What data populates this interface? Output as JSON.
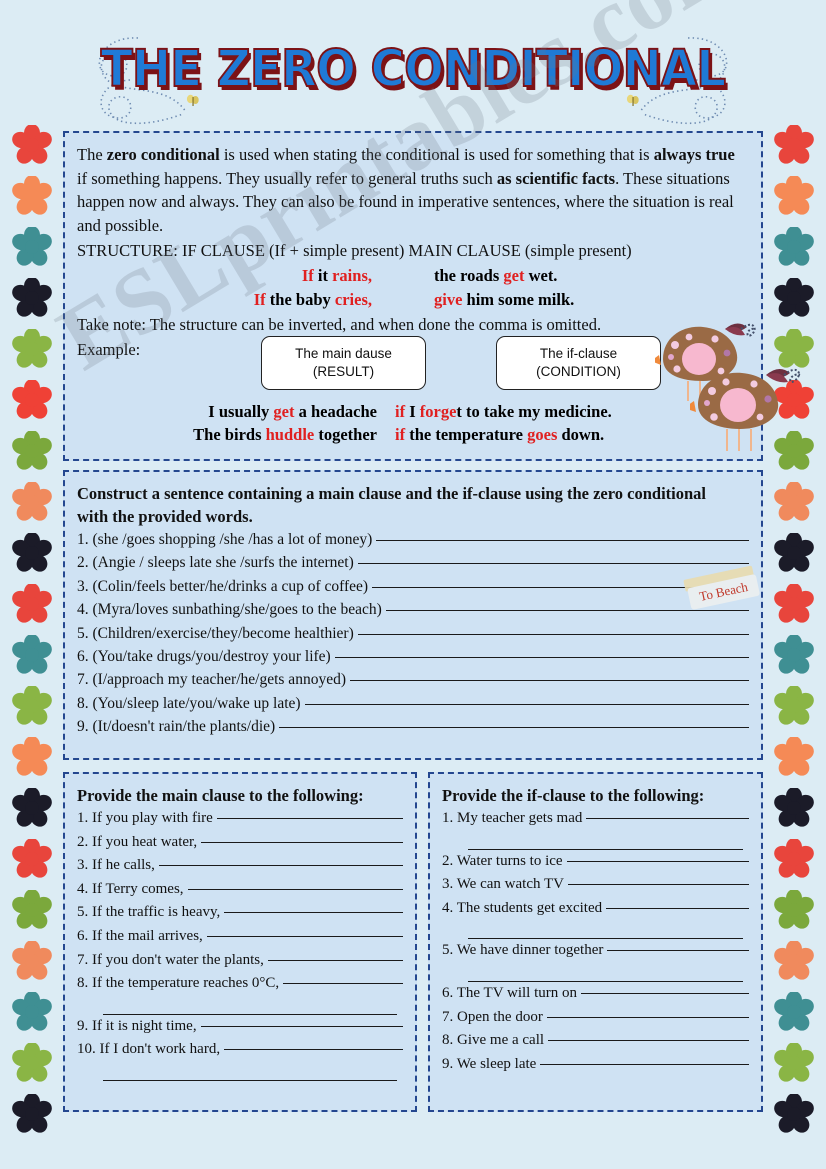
{
  "title": "THE ZERO CONDITIONAL",
  "watermark": "ESLprintables.com",
  "colors": {
    "page_background": "#dcecf4",
    "panel_background": "#cfe2f3",
    "panel_border": "#24478f",
    "title_fill": "#1f7ad6",
    "title_shadow": "#7c1216",
    "highlight_red": "#e02020"
  },
  "explanation": {
    "paragraph_parts": [
      {
        "text": "The ",
        "bold": false
      },
      {
        "text": "zero conditional",
        "bold": true
      },
      {
        "text": " is used when stating the conditional is used for something that is ",
        "bold": false
      },
      {
        "text": "always true",
        "bold": true
      },
      {
        "text": " if something happens. They usually refer to general truths such ",
        "bold": false
      },
      {
        "text": "as scientific facts",
        "bold": true
      },
      {
        "text": ". These situations happen now and always. They can also be found in imperative sentences, where the situation is real and possible.",
        "bold": false
      }
    ],
    "paragraph_plain": "The zero conditional is used when stating the conditional is used for something that is always true if something happens. They usually refer to general truths such as scientific facts. These situations happen now and always. They can also be found in imperative sentences, where the situation is real and possible.",
    "structure_line": "STRUCTURE: IF CLAUSE (If + simple present)   MAIN CLAUSE (simple present)",
    "examples": [
      {
        "if_pre": "If",
        "if_highlight": " it rains,",
        "if_plain_1": " it ",
        "if_word": "rains,",
        "main_pre": "the roads ",
        "main_word": "get",
        "main_post": " wet."
      },
      {
        "if_pre": "If",
        "if_plain_1": " the baby ",
        "if_word": "cries,",
        "main_pre": "",
        "main_word": "give",
        "main_post": " him some milk."
      }
    ],
    "example_1_if_lead": "If",
    "example_1_if_mid": " it ",
    "example_1_if_red": "rains,",
    "example_1_main_lead": "the roads ",
    "example_1_main_red": "get",
    "example_1_main_tail": " wet.",
    "example_2_if_lead": "If",
    "example_2_if_mid": " the baby ",
    "example_2_if_red": "cries,",
    "example_2_main_red": "give",
    "example_2_main_tail": " him some milk.",
    "take_note": "Take note: The structure can be inverted, and when done the comma is omitted.",
    "example_label": "Example:",
    "box_main": {
      "line1": "The main dause",
      "line2": "(RESULT)"
    },
    "box_if": {
      "line1": "The if-clause",
      "line2": "(CONDITION)"
    },
    "inverted_examples": [
      {
        "left_pre": "I usually ",
        "left_red": "get",
        "left_post": " a headache",
        "right_red1": "if",
        "right_mid": " I ",
        "right_red2": "forge",
        "right_post": "t to take my medicine."
      },
      {
        "left_pre": "The birds ",
        "left_red": "huddle",
        "left_post": " together",
        "right_red1": "if",
        "right_mid": " the temperature ",
        "right_red2": "goes",
        "right_post": " down."
      }
    ]
  },
  "construct": {
    "instruction_line1": "Construct a sentence containing a main clause and the if-clause using the zero conditional",
    "instruction_line2": "with the provided words.",
    "items": [
      "1. (she /goes shopping /she /has a lot of money)",
      "2. (Angie / sleeps late  she /surfs the internet)",
      "3. (Colin/feels better/he/drinks a cup of coffee)",
      "4. (Myra/loves sunbathing/she/goes to the beach)",
      "5. (Children/exercise/they/become healthier)",
      "6. (You/take drugs/you/destroy your life)",
      "7. (I/approach my teacher/he/gets annoyed)",
      "8. (You/sleep late/you/wake up late)",
      "9. (It/doesn't rain/the plants/die)"
    ]
  },
  "main_clause_section": {
    "heading": "Provide the main clause to the following:",
    "items": [
      {
        "text": "1. If you play with fire",
        "continuation": false
      },
      {
        "text": "2. If you heat water,",
        "continuation": false
      },
      {
        "text": "3. If he calls,",
        "continuation": false
      },
      {
        "text": "4. If Terry comes,",
        "continuation": false
      },
      {
        "text": "5. If the traffic is heavy,",
        "continuation": false
      },
      {
        "text": "6. If  the mail arrives,",
        "continuation": false
      },
      {
        "text": "7. If you don't water the plants,",
        "continuation": false
      },
      {
        "text": "8. If  the temperature reaches 0°C,",
        "continuation": true
      },
      {
        "text": "9. If it is night time,",
        "continuation": false
      },
      {
        "text": "10. If I don't work hard,",
        "continuation": true
      }
    ]
  },
  "if_clause_section": {
    "heading": "Provide the if-clause to the following:",
    "items": [
      {
        "text": "1. My teacher gets mad",
        "continuation": true
      },
      {
        "text": "2. Water turns to ice",
        "continuation": false
      },
      {
        "text": "3. We can watch TV",
        "continuation": false
      },
      {
        "text": "4. The students get excited",
        "continuation": true
      },
      {
        "text": "5. We have dinner together",
        "continuation": true
      },
      {
        "text": "6. The TV will turn on",
        "continuation": false
      },
      {
        "text": "7. Open the door",
        "continuation": false
      },
      {
        "text": "8. Give me a call",
        "continuation": false
      },
      {
        "text": "9. We sleep late",
        "continuation": false
      }
    ]
  },
  "sticker": {
    "label": "To Beach"
  },
  "border_flowers": {
    "colors": [
      "#e8453c",
      "#f58a56",
      "#3f8f93",
      "#1b1b28",
      "#8ab545",
      "#ef4136",
      "#7ba83c",
      "#f08a5d",
      "#1b1b28",
      "#e8453c",
      "#3f8f93",
      "#8ab545",
      "#f58a56",
      "#1b1b28",
      "#e8453c",
      "#7ba83c",
      "#f08a5d",
      "#3f8f93",
      "#8ab545",
      "#1b1b28"
    ]
  }
}
